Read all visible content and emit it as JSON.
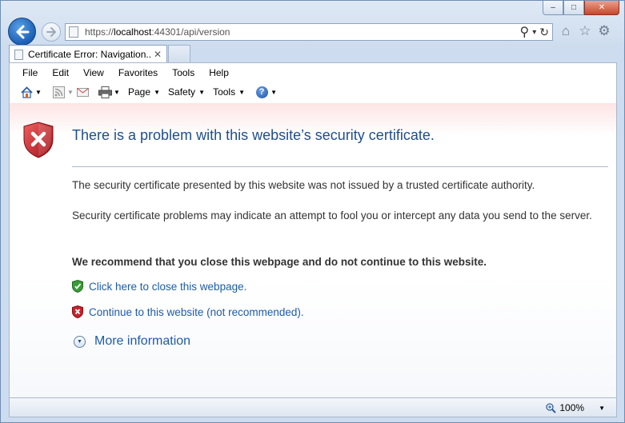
{
  "window": {
    "minimize_glyph": "–",
    "maximize_glyph": "□",
    "close_glyph": "✕"
  },
  "nav": {
    "back_icon": "back-arrow-icon",
    "forward_icon": "forward-arrow-icon"
  },
  "address": {
    "scheme": "https://",
    "host": "localhost",
    "rest": ":44301/api/version",
    "search_glyph": "⚲",
    "dropdown_glyph": "▾",
    "refresh_glyph": "↻"
  },
  "toolbar_right": {
    "home_glyph": "⌂",
    "favorites_glyph": "☆",
    "tools_glyph": "⚙"
  },
  "tab": {
    "title": "Certificate Error: Navigation...",
    "close_glyph": "✕"
  },
  "menu": [
    "File",
    "Edit",
    "View",
    "Favorites",
    "Tools",
    "Help"
  ],
  "command_bar": {
    "page_label": "Page",
    "safety_label": "Safety",
    "tools_label": "Tools",
    "help_glyph": "?",
    "arrow_glyph": "▼"
  },
  "content": {
    "title": "There is a problem with this website’s security certificate.",
    "para1": "The security certificate presented by this website was not issued by a trusted certificate authority.",
    "para2": "Security certificate problems may indicate an attempt to fool you or intercept any data you send to the server.",
    "recommend": "We recommend that you close this webpage and do not continue to this website.",
    "close_link": "Click here to close this webpage.",
    "continue_link": "Continue to this website (not recommended).",
    "more_info": "More information",
    "more_glyph": "▼"
  },
  "status": {
    "zoom": "100%",
    "zoom_glyph": "▼"
  },
  "colors": {
    "link": "#1d5ca8",
    "title": "#1f4e8c",
    "shield_red": "#c8232c",
    "shield_green": "#3a9a3a"
  }
}
